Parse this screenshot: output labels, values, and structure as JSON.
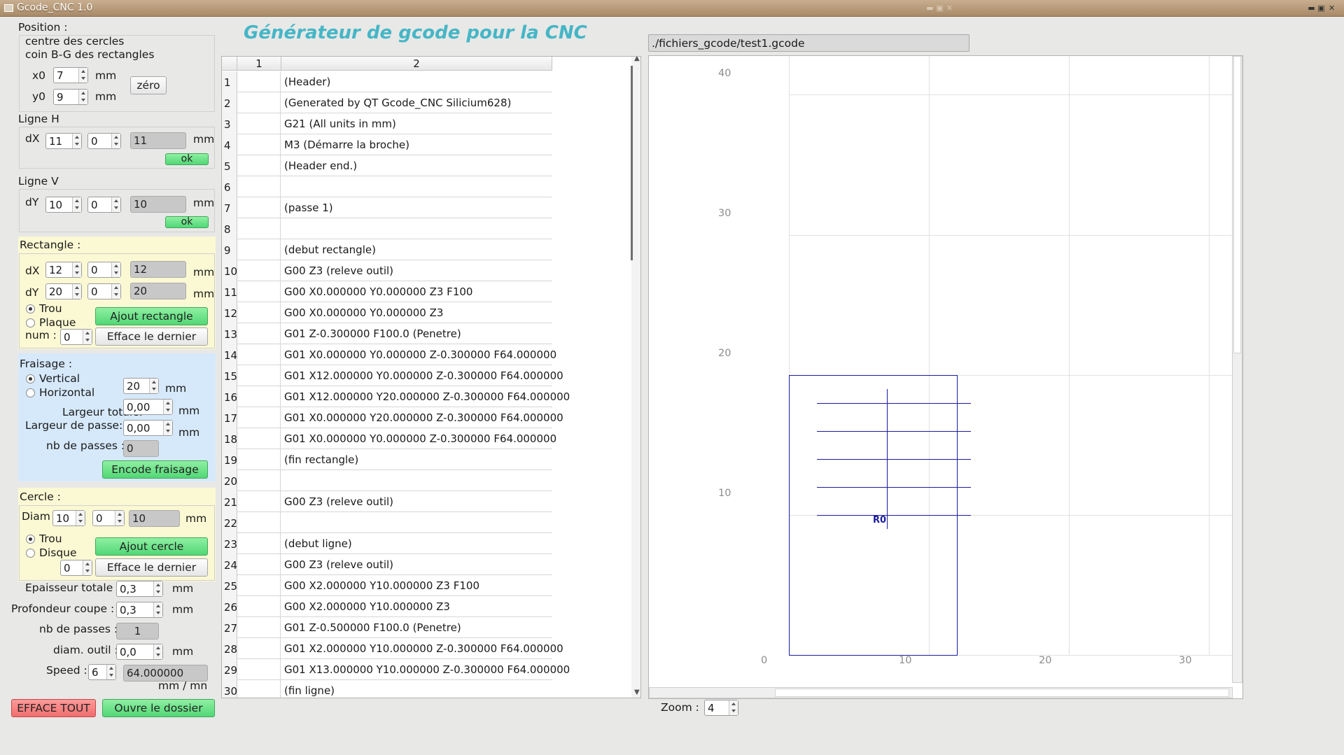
{
  "window": {
    "title": "Gcode_CNC 1.0"
  },
  "left": {
    "position": {
      "title": "Position :",
      "line1": "centre des cercles",
      "line2": "coin B-G des rectangles",
      "x0_label": "x0",
      "x0": "7",
      "y0_label": "y0",
      "y0": "9",
      "unit": "mm",
      "zero_btn": "zéro"
    },
    "ligne_h": {
      "title": "Ligne H",
      "dx_label": "dX",
      "a": "11",
      "b": "0",
      "result": "11",
      "unit": "mm",
      "ok": "ok"
    },
    "ligne_v": {
      "title": "Ligne V",
      "dy_label": "dY",
      "a": "10",
      "b": "0",
      "result": "10",
      "unit": "mm",
      "ok": "ok"
    },
    "rect": {
      "title": "Rectangle :",
      "dx_label": "dX",
      "dx_a": "12",
      "dx_b": "0",
      "dx_res": "12",
      "dy_label": "dY",
      "dy_a": "20",
      "dy_b": "0",
      "dy_res": "20",
      "unit": "mm",
      "trou": "Trou",
      "plaque": "Plaque",
      "num_label": "num :",
      "num": "0",
      "add_btn": "Ajout rectangle",
      "del_btn": "Efface le dernier"
    },
    "fraisage": {
      "title": "Fraisage :",
      "vertical": "Vertical",
      "horizontal": "Horizontal",
      "val": "20",
      "unit": "mm",
      "lt_label": "Largeur totale:",
      "lt": "0,00",
      "lp_label": "Largeur de passe:",
      "lp": "0,00",
      "nb_label": "nb de passes :",
      "nb": "0",
      "btn": "Encode fraisage"
    },
    "cercle": {
      "title": "Cercle :",
      "diam_label": "Diam",
      "a": "10",
      "b": "0",
      "res": "10",
      "unit": "mm",
      "trou": "Trou",
      "disque": "Disque",
      "num": "0",
      "add_btn": "Ajout cercle",
      "del_btn": "Efface le dernier"
    },
    "params": {
      "ep_label": "Epaisseur totale :",
      "ep": "0,3",
      "prof_label": "Profondeur coupe :",
      "prof": "0,3",
      "nb_label": "nb de passes :",
      "nb": "1",
      "diam_label": "diam. outil :",
      "diam": "0,0",
      "speed_label": "Speed :",
      "speed": "6",
      "speed_val": "64.000000",
      "unit": "mm",
      "speed_unit": "mm / mn"
    },
    "bottom": {
      "efface": "EFFACE TOUT",
      "ouvre": "Ouvre le dossier"
    }
  },
  "header": {
    "title": "Générateur de gcode pour la CNC",
    "path": "./fichiers_gcode/test1.gcode"
  },
  "table": {
    "col1": "1",
    "col2": "2",
    "rows": [
      {
        "n": "1",
        "t": "(Header)"
      },
      {
        "n": "2",
        "t": "(Generated by QT Gcode_CNC Silicium628)"
      },
      {
        "n": "3",
        "t": "G21 (All units in mm)"
      },
      {
        "n": "4",
        "t": "M3 (Démarre la broche)"
      },
      {
        "n": "5",
        "t": "(Header end.)"
      },
      {
        "n": "6",
        "t": ""
      },
      {
        "n": "7",
        "t": "(passe 1)"
      },
      {
        "n": "8",
        "t": ""
      },
      {
        "n": "9",
        "t": "(debut rectangle)"
      },
      {
        "n": "10",
        "t": "G00 Z3 (releve outil)"
      },
      {
        "n": "11",
        "t": "G00 X0.000000 Y0.000000 Z3 F100"
      },
      {
        "n": "12",
        "t": "G00 X0.000000 Y0.000000 Z3"
      },
      {
        "n": "13",
        "t": "G01 Z-0.300000 F100.0 (Penetre)"
      },
      {
        "n": "14",
        "t": "G01 X0.000000 Y0.000000 Z-0.300000 F64.000000"
      },
      {
        "n": "15",
        "t": "G01 X12.000000 Y0.000000 Z-0.300000 F64.000000"
      },
      {
        "n": "16",
        "t": "G01 X12.000000 Y20.000000 Z-0.300000 F64.000000"
      },
      {
        "n": "17",
        "t": "G01 X0.000000 Y20.000000 Z-0.300000 F64.000000"
      },
      {
        "n": "18",
        "t": "G01 X0.000000 Y0.000000 Z-0.300000 F64.000000"
      },
      {
        "n": "19",
        "t": "(fin rectangle)"
      },
      {
        "n": "20",
        "t": ""
      },
      {
        "n": "21",
        "t": "G00 Z3 (releve outil)"
      },
      {
        "n": "22",
        "t": ""
      },
      {
        "n": "23",
        "t": "(debut ligne)"
      },
      {
        "n": "24",
        "t": "G00 Z3 (releve outil)"
      },
      {
        "n": "25",
        "t": "G00 X2.000000 Y10.000000 Z3 F100"
      },
      {
        "n": "26",
        "t": "G00 X2.000000 Y10.000000 Z3"
      },
      {
        "n": "27",
        "t": "G01 Z-0.500000 F100.0 (Penetre)"
      },
      {
        "n": "28",
        "t": "G01 X2.000000 Y10.000000 Z-0.300000 F64.000000"
      },
      {
        "n": "29",
        "t": "G01 X13.000000 Y10.000000 Z-0.300000 F64.000000"
      },
      {
        "n": "30",
        "t": "(fin ligne)"
      }
    ]
  },
  "plot": {
    "x_ticks": [
      "0",
      "10",
      "20",
      "30"
    ],
    "y_ticks": [
      "40",
      "30",
      "20",
      "10"
    ],
    "marker": "R0",
    "zoom_label": "Zoom :",
    "zoom": "4",
    "stroke_color": "#1b1b9e"
  }
}
